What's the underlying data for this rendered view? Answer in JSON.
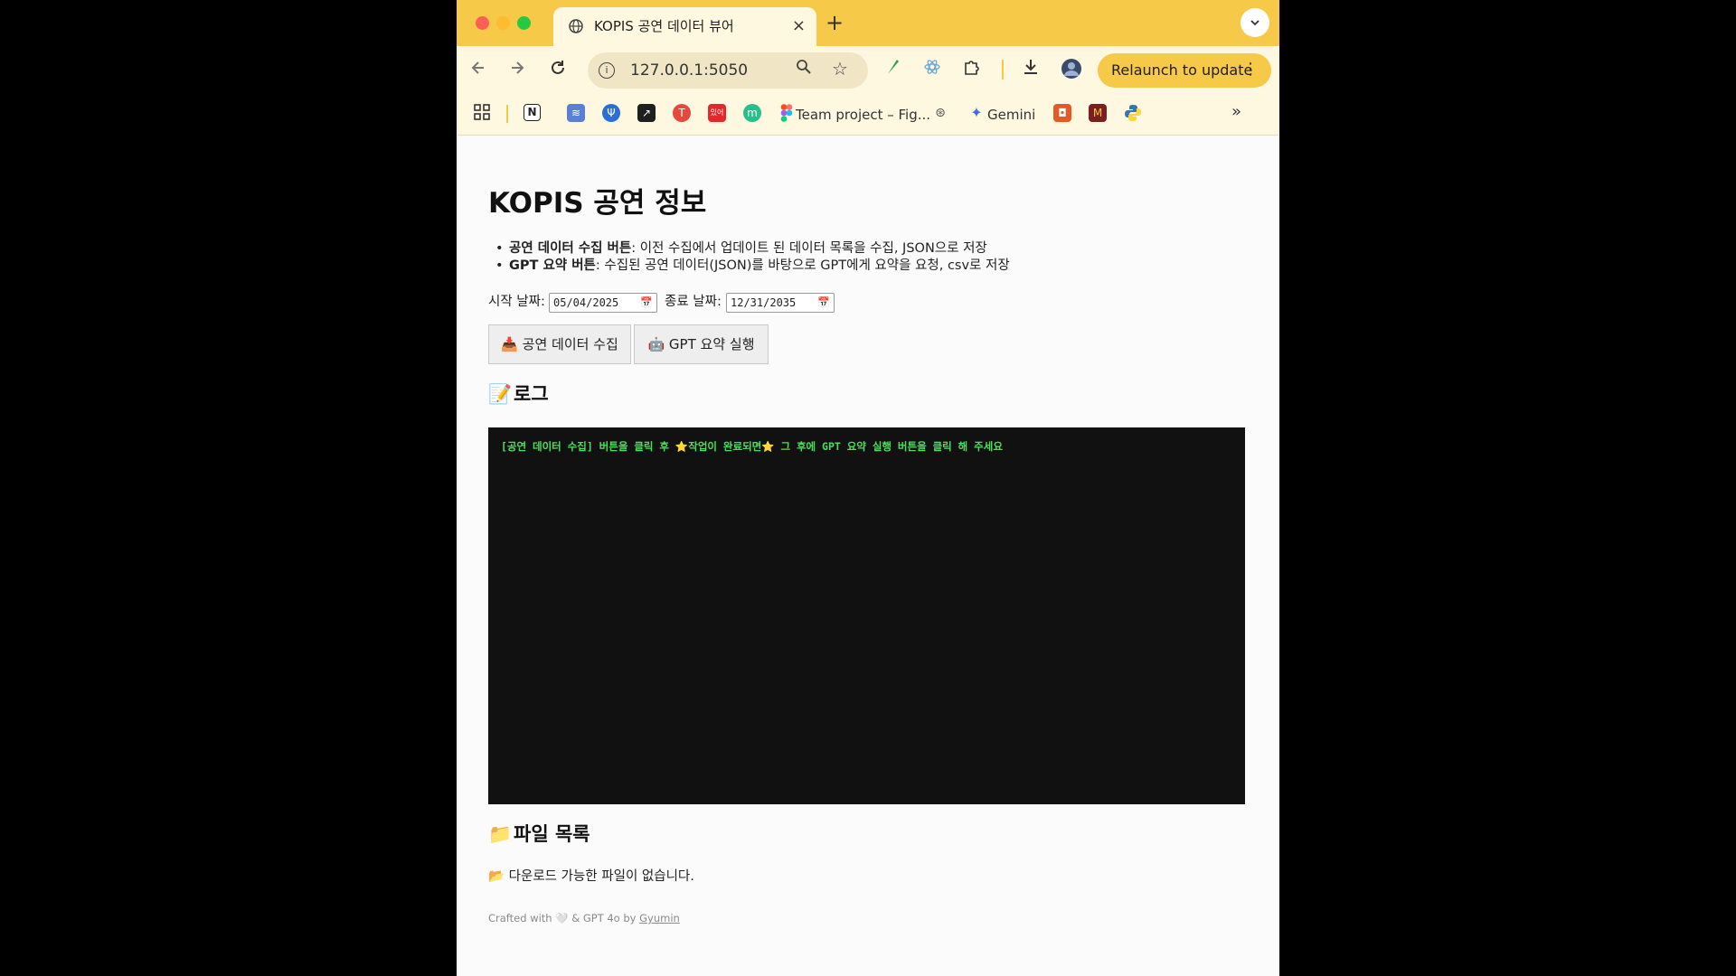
{
  "browser": {
    "tab_title": "KOPIS 공연 데이터 뷰어",
    "tab_close": "×",
    "new_tab": "+",
    "url": "127.0.0.1:5050",
    "relaunch_label": "Relaunch to update",
    "bookmarks": {
      "figma_label": "Team project – Fig...",
      "gemini_label": "Gemini",
      "more": "»"
    },
    "accent": "#f7c948"
  },
  "page": {
    "title": "KOPIS 공연 정보",
    "bullets": [
      {
        "bold": "공연 데이터 수집 버튼",
        "text": ": 이전 수집에서 업데이트 된 데이터 목록을 수집, JSON으로 저장"
      },
      {
        "bold": "GPT 요약 버튼",
        "text": ": 수집된 공연 데이터(JSON)를 바탕으로 GPT에게 요약을 요청, csv로 저장"
      }
    ],
    "start_label": "시작 날짜:",
    "start_value": "05/04/2025",
    "end_label": "종료 날짜:",
    "end_value": "12/31/2035",
    "collect_button": "📥 공연 데이터 수집",
    "gpt_button": "🤖 GPT 요약 실행",
    "log_heading": "로그",
    "log_text": "[공연 데이터 수집] 버튼을 클릭 후 ⭐작업이 완료되면⭐ 그 후에 GPT 요약 실행 버튼을 클릭 해 주세요",
    "files_heading": "파일 목록",
    "files_empty": "📂 다운로드 가능한 파일이 없습니다.",
    "footer_text": "Crafted with 🤍 & GPT 4o by ",
    "footer_link": "Gyumin"
  }
}
